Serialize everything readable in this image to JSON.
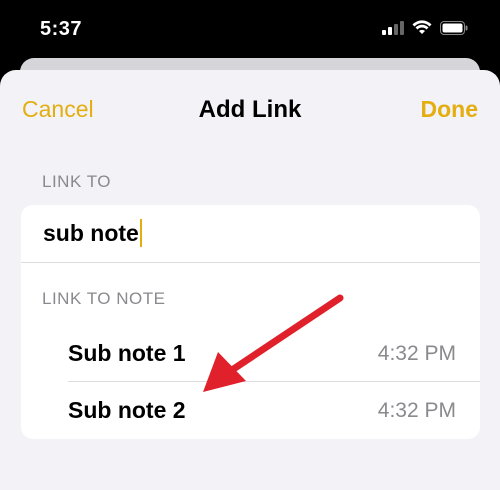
{
  "status": {
    "time": "5:37"
  },
  "nav": {
    "cancel": "Cancel",
    "title": "Add Link",
    "done": "Done"
  },
  "link_to": {
    "header": "LINK TO",
    "value": "sub note"
  },
  "link_to_note": {
    "header": "LINK TO NOTE",
    "items": [
      {
        "title": "Sub note 1",
        "time": "4:32 PM"
      },
      {
        "title": "Sub note 2",
        "time": "4:32 PM"
      }
    ]
  },
  "colors": {
    "accent": "#e4ae11",
    "annotation": "#e0202a",
    "background": "#f2f2f7"
  },
  "icons": [
    "cellular-signal-icon",
    "wifi-icon",
    "battery-icon",
    "annotation-arrow-icon"
  ]
}
